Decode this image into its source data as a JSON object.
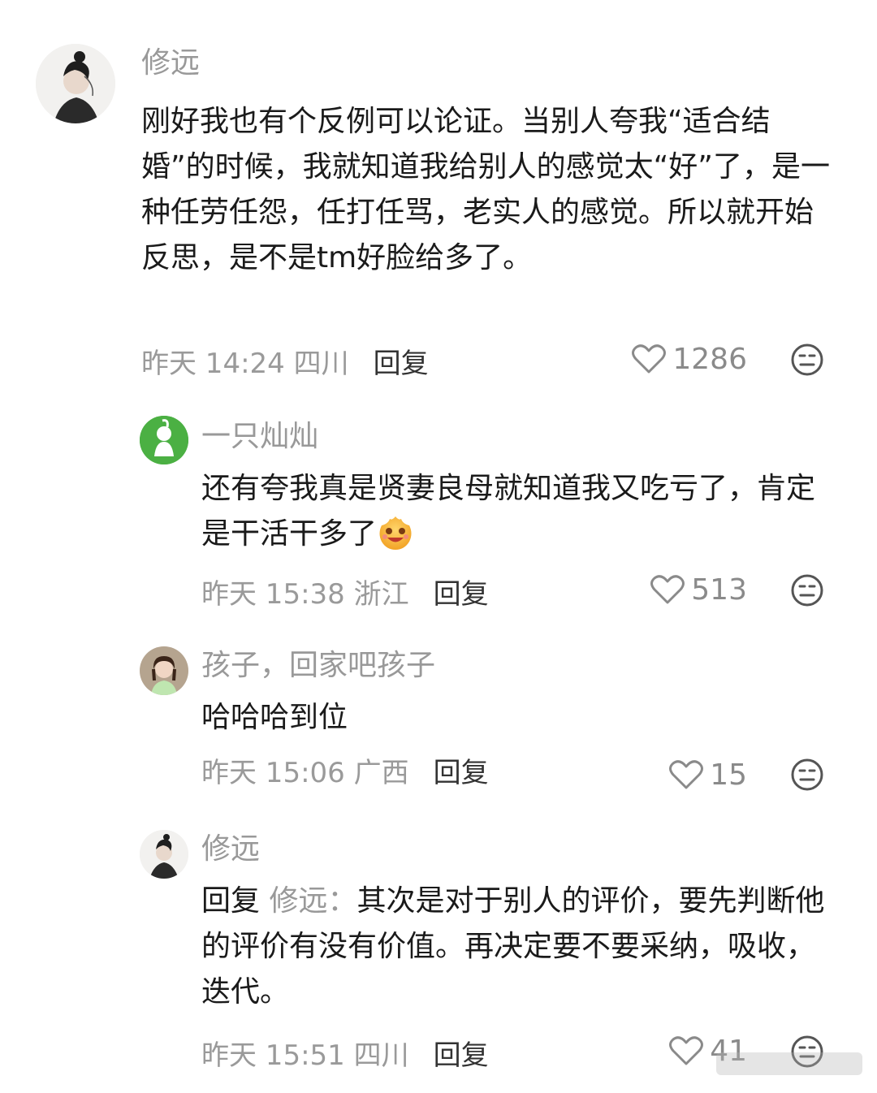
{
  "comments": [
    {
      "username": "修远",
      "text": "刚好我也有个反例可以论证。当别人夸我“适合结婚”的时候，我就知道我给别人的感觉太“好”了，是一种任劳任怨，任打任骂，老实人的感觉。所以就开始反思，是不是tm好脸给多了。",
      "time": "昨天 14:24 四川",
      "reply_label": "回复",
      "likes": "1286"
    },
    {
      "username": "一只灿灿",
      "text": "还有夸我真是贤妻良母就知道我又吃亏了，肯定是干活干多了",
      "time": "昨天 15:38 浙江",
      "reply_label": "回复",
      "likes": "513"
    },
    {
      "username": "孩子，回家吧孩子",
      "text": "哈哈哈到位",
      "time": "昨天 15:06 广西",
      "reply_label": "回复",
      "likes": "15"
    },
    {
      "username": "修远",
      "reply_prefix": "回复",
      "reply_to": "修远：",
      "text": "其次是对于别人的评价，要先判断他的评价有没有价值。再决定要不要采纳，吸收，迭代。",
      "time": "昨天 15:51 四川",
      "reply_label": "回复",
      "likes": "41"
    }
  ],
  "icons": {
    "like": "heart-outline-icon",
    "dislike": "neutral-face-icon",
    "emoji": "smiling-face-emoji"
  },
  "colors": {
    "username": "#999999",
    "meta": "#9a9a9a",
    "text": "#1a1a1a"
  }
}
